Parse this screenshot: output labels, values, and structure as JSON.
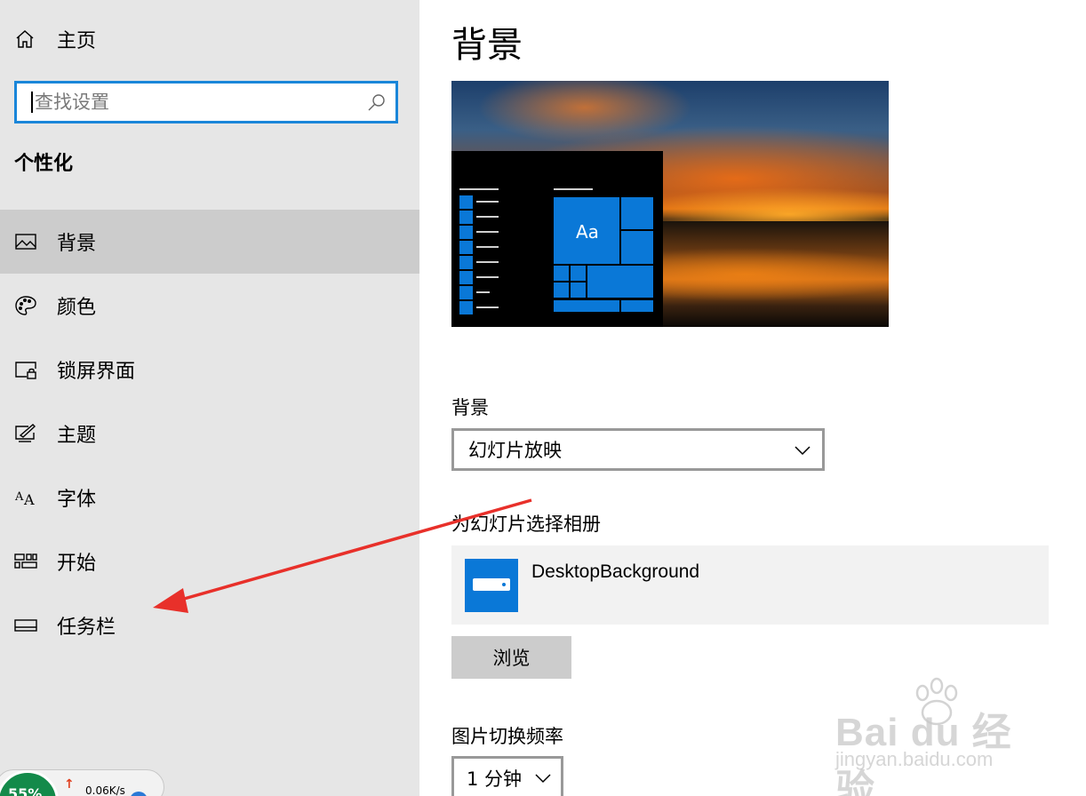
{
  "sidebar": {
    "home_label": "主页",
    "search_placeholder": "查找设置",
    "section_title": "个性化",
    "items": [
      {
        "label": "背景",
        "icon": "picture-icon",
        "active": true
      },
      {
        "label": "颜色",
        "icon": "palette-icon",
        "active": false
      },
      {
        "label": "锁屏界面",
        "icon": "lock-screen-icon",
        "active": false
      },
      {
        "label": "主题",
        "icon": "theme-icon",
        "active": false
      },
      {
        "label": "字体",
        "icon": "font-icon",
        "active": false
      },
      {
        "label": "开始",
        "icon": "start-icon",
        "active": false
      },
      {
        "label": "任务栏",
        "icon": "taskbar-icon",
        "active": false
      }
    ],
    "widget": {
      "speed": "0.06K/s",
      "percent": "55%"
    }
  },
  "main": {
    "title": "背景",
    "preview": {
      "tile_text": "Aa"
    },
    "background_label": "背景",
    "background_value": "幻灯片放映",
    "album_label": "为幻灯片选择相册",
    "album_name": "DesktopBackground",
    "browse_label": "浏览",
    "frequency_label": "图片切换频率",
    "frequency_value": "1 分钟"
  },
  "watermark": {
    "brand": "Bai du 经验",
    "site": "jingyan.baidu.com"
  },
  "colors": {
    "accent": "#0a78d7",
    "sidebar_bg": "#e6e6e6",
    "active_bg": "#cccccc",
    "annotation": "#e8302a"
  }
}
